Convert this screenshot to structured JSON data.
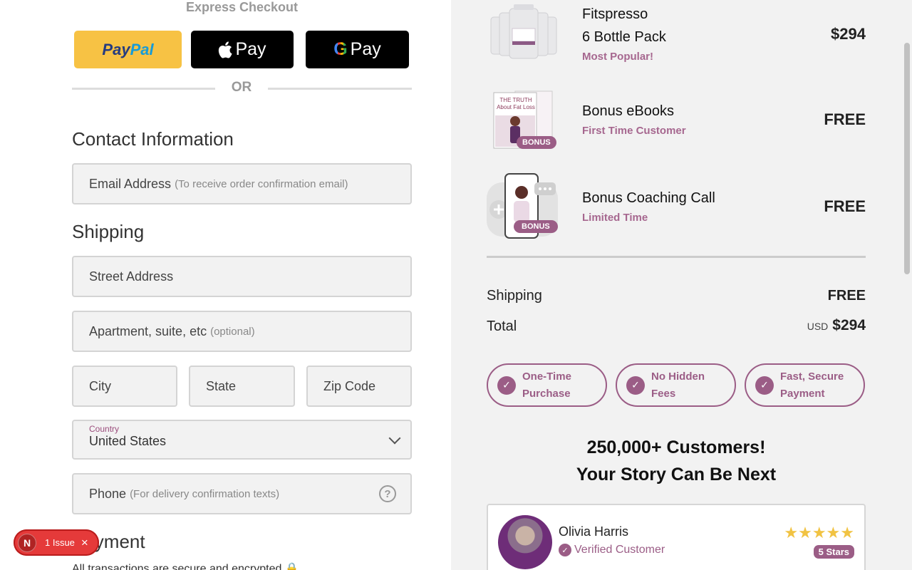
{
  "express": {
    "title": "Express Checkout",
    "paypal_a": "Pay",
    "paypal_b": "Pal",
    "apple_label": "Pay",
    "gpay_label": "Pay",
    "or_label": "OR"
  },
  "contact": {
    "heading": "Contact Information",
    "email_label": "Email Address",
    "email_hint": "(To receive order confirmation email)"
  },
  "shipping": {
    "heading": "Shipping",
    "street_label": "Street Address",
    "apt_label": "Apartment, suite, etc",
    "apt_hint": "(optional)",
    "city_label": "City",
    "state_label": "State",
    "zip_label": "Zip Code",
    "country_label": "Country",
    "country_value": "United States",
    "phone_label": "Phone",
    "phone_hint": "(For delivery confirmation texts)",
    "help_icon": "?"
  },
  "payment": {
    "heading": "Payment",
    "secure_text": "All transactions are secure and encrypted"
  },
  "issue_badge": {
    "letter": "N",
    "text": "1 Issue",
    "close": "×"
  },
  "order": {
    "items": [
      {
        "name_line1": "Fitspresso",
        "name_line2": "6 Bottle Pack",
        "sub": "Most Popular!",
        "price": "$294"
      },
      {
        "name_line1": "Bonus eBooks",
        "sub": "First Time Customer",
        "price": "FREE",
        "badge": "BONUS",
        "cover_title": "THE TRUTH About Fat Loss"
      },
      {
        "name_line1": "Bonus Coaching Call",
        "sub": "Limited Time",
        "price": "FREE",
        "badge": "BONUS"
      }
    ],
    "shipping_label": "Shipping",
    "shipping_value": "FREE",
    "total_label": "Total",
    "total_currency": "USD",
    "total_value": "$294"
  },
  "guarantees": [
    {
      "line1": "One-Time",
      "line2": "Purchase"
    },
    {
      "line1": "No Hidden",
      "line2": "Fees"
    },
    {
      "line1": "Fast, Secure",
      "line2": "Payment"
    }
  ],
  "customers": {
    "line1": "250,000+ Customers!",
    "line2": "Your Story Can Be Next"
  },
  "review": {
    "name": "Olivia Harris",
    "verified": "Verified Customer",
    "stars": "★★★★★",
    "stars_label": "5 Stars"
  },
  "colors": {
    "accent": "#9b5d86",
    "paypal_yellow": "#f7c244",
    "issue_red": "#e53a3a"
  }
}
